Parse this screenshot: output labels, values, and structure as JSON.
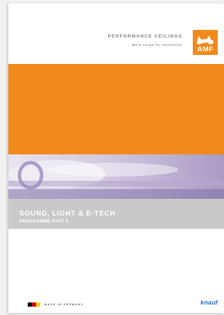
{
  "header": {
    "title": "PERFORMANCE CEILINGS",
    "subtitle": "More scope for innovation"
  },
  "brand": {
    "logo_text": "AMF",
    "logo_icon": "cat-silhouette-icon",
    "accent_color": "#f08a1c"
  },
  "cover": {
    "title": "SOUND, LIGHT & E-TECH",
    "subtitle": "PROGRAMME PART 5",
    "band_color": "#c9c9c9"
  },
  "footer": {
    "made_in": "MADE IN GERMANY",
    "flag_colors": [
      "#000000",
      "#d40000",
      "#ffcc00"
    ],
    "partner_logo": "knauf"
  }
}
